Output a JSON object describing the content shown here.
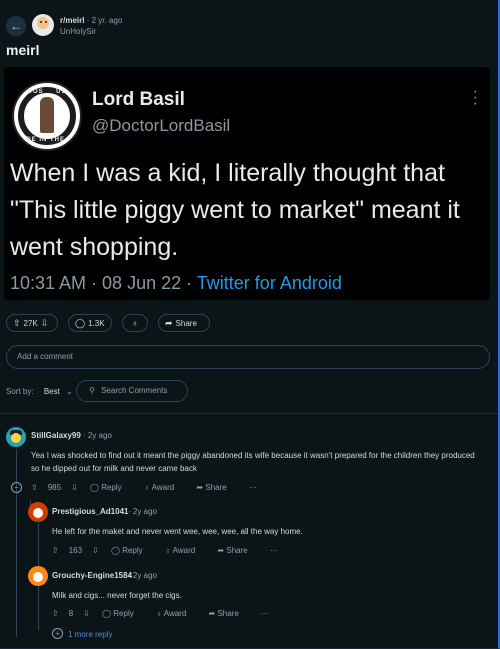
{
  "header": {
    "subreddit": "r/meirl",
    "age": "· 2 yr. ago",
    "username": "UnHolySir",
    "back_icon": "arrow-left-icon"
  },
  "post": {
    "title": "meirl",
    "tweet": {
      "display_name": "Lord Basil",
      "handle": "@DoctorLordBasil",
      "body": "When I was a kid, I literally thought that \"This little piggy went to market\" meant it went shopping.",
      "timestamp": "10:31 AM · 08 Jun 22 · ",
      "source": "Twitter for Android",
      "avatar_text_left": "ADOS",
      "avatar_text_right": "USA",
      "avatar_text_bottom": "ADE IN THE U"
    },
    "actions": {
      "votes": "27K",
      "comments": "1.3K",
      "share": "Share"
    }
  },
  "add_comment_placeholder": "Add a comment",
  "sort": {
    "label": "Sort by:",
    "value": "Best"
  },
  "search_comments_label": "Search Comments",
  "comments": [
    {
      "user": "StillGalaxy99",
      "age": "· 2y ago",
      "body": "Yea I was shocked to find out it meant the piggy abandoned its wife because it wasn't prepared for the children they produced so he dipped out for milk and never came back",
      "votes": "985",
      "reply": "Reply",
      "award": "Award",
      "share": "Share",
      "more": "···"
    },
    {
      "user": "Prestigious_Ad1041",
      "age": "· 2y ago",
      "body": "He left for the maket and never went wee, wee, wee, all the way home.",
      "votes": "163",
      "reply": "Reply",
      "award": "Award",
      "share": "Share",
      "more": "···"
    },
    {
      "user": "Grouchy-Engine1584",
      "age": "· 2y ago",
      "body": "Milk and cigs... never forget the cigs.",
      "votes": "8",
      "reply": "Reply",
      "award": "Award",
      "share": "Share",
      "more": "···"
    }
  ],
  "more_replies": "1 more reply",
  "colors": {
    "background": "#0b1416",
    "link": "#1d9bf0",
    "muted": "#8ba2ad"
  }
}
